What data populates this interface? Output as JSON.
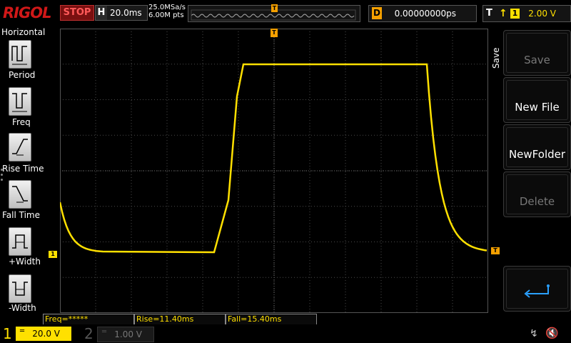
{
  "brand": "RIGOL",
  "run_state": "STOP",
  "horizontal": {
    "label": "H",
    "timebase": "20.0ms"
  },
  "acquisition": {
    "sample_rate": "25.0MSa/s",
    "memory_depth": "6.00M pts"
  },
  "trigger_position_marker": "T",
  "delay": {
    "label": "D",
    "value": "0.00000000ps"
  },
  "trigger": {
    "label": "T",
    "edge": "rising",
    "source": "1",
    "level": "2.00 V"
  },
  "left_menu": {
    "title": "Horizontal",
    "items": [
      {
        "label": "Period",
        "icon": "period-icon"
      },
      {
        "label": "Freq",
        "icon": "frequency-icon"
      },
      {
        "label": "Rise Time",
        "icon": "rise-time-icon"
      },
      {
        "label": "Fall Time",
        "icon": "fall-time-icon"
      },
      {
        "label": "+Width",
        "icon": "positive-width-icon"
      },
      {
        "label": "-Width",
        "icon": "negative-width-icon"
      }
    ]
  },
  "right_menu": {
    "title": "Save",
    "items": [
      {
        "label": "Save",
        "enabled": false
      },
      {
        "label": "New File",
        "enabled": true
      },
      {
        "label": "NewFolder",
        "enabled": true
      },
      {
        "label": "Delete",
        "enabled": false
      },
      {
        "label": "",
        "icon": "return-arrow-icon",
        "enabled": true
      }
    ]
  },
  "measurements": {
    "freq": "Freq=*****",
    "rise": "Rise=11.40ms",
    "fall": "Fall=15.40ms"
  },
  "channels": {
    "ch1": {
      "number": "1",
      "coupling": "DC",
      "scale": "20.0 V",
      "active": true
    },
    "ch2": {
      "number": "2",
      "coupling": "DC",
      "scale": "1.00 V",
      "active": false
    }
  },
  "markers": {
    "ch1_ground": "1",
    "trigger_level": "T"
  },
  "colors": {
    "ch1": "#ffe000",
    "trigger": "#f5a000",
    "stop": "#d01818",
    "grid": "#4a4a4a"
  },
  "status_icons": [
    "usb-icon",
    "speaker-muted-icon"
  ]
}
